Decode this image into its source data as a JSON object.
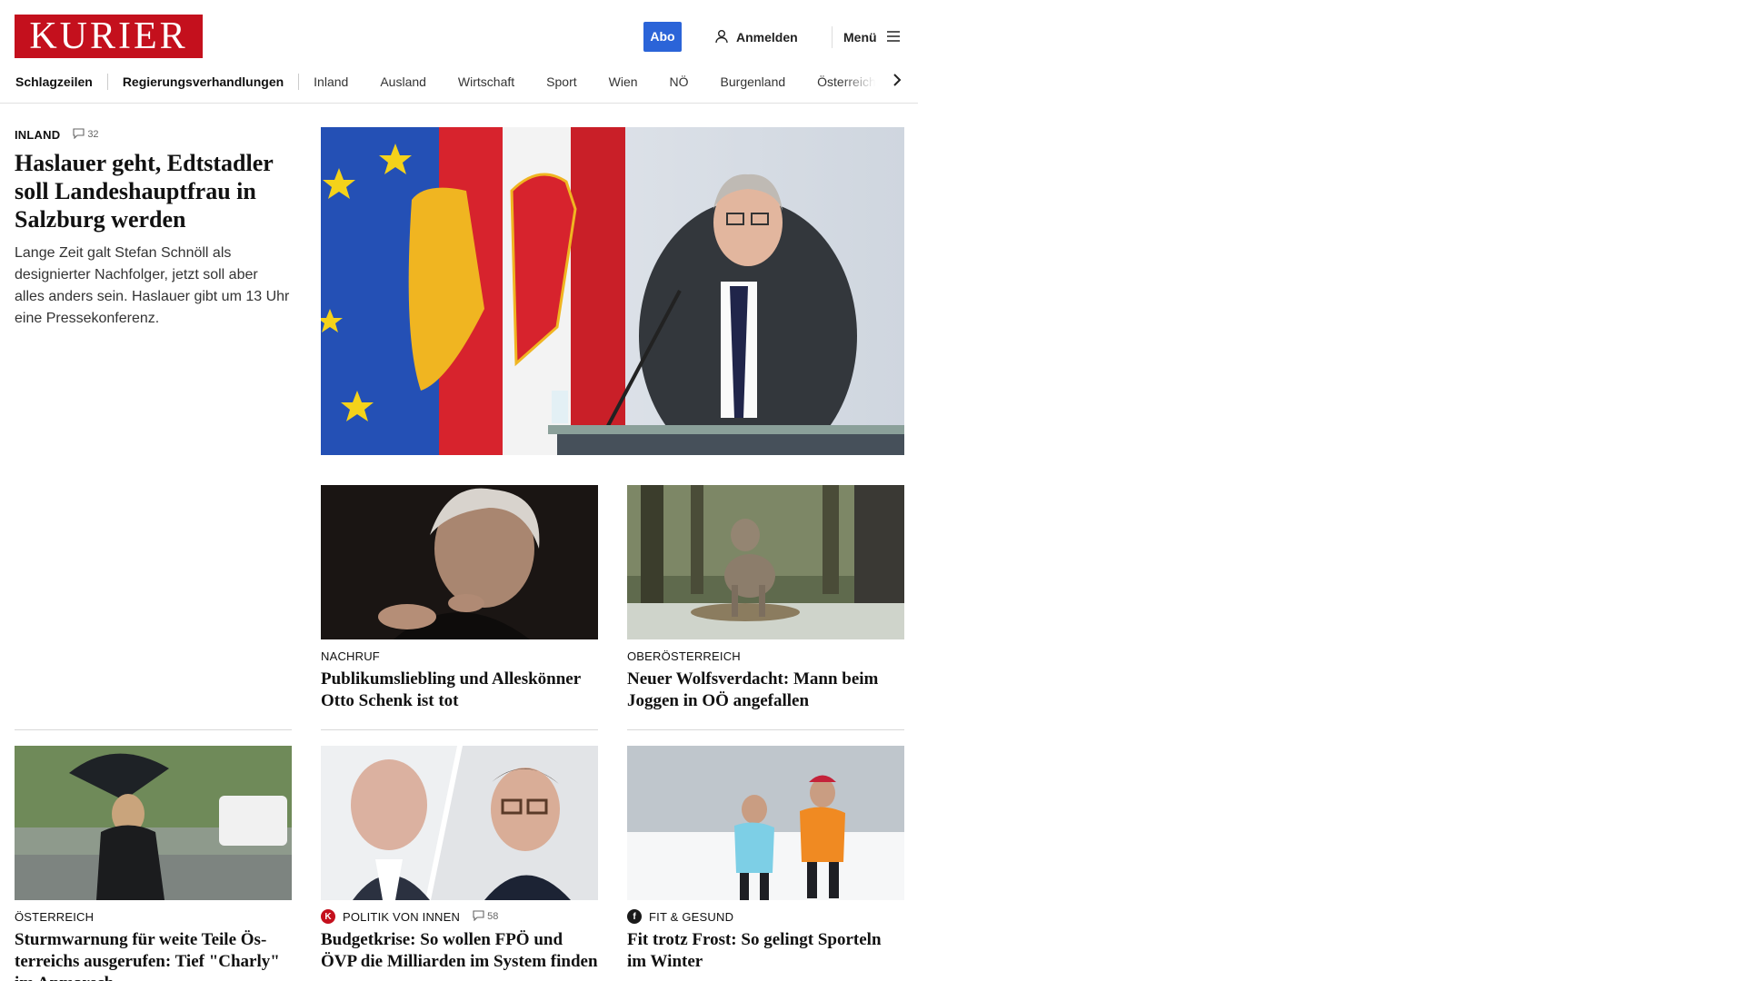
{
  "header": {
    "logo_text": "KURIER",
    "abo_label": "Abo",
    "login_label": "Anmelden",
    "menu_label": "Menü",
    "brand_color": "#c4101d",
    "accent_color": "#2b64d8"
  },
  "nav": {
    "items": [
      "Schlagzeilen",
      "Regierungsverhandlungen",
      "Inland",
      "Ausland",
      "Wirtschaft",
      "Sport",
      "Wien",
      "NÖ",
      "Burgenland",
      "Österreich"
    ]
  },
  "lead": {
    "kicker": "INLAND",
    "comments": "32",
    "title": "Haslauer geht, Edtstadler soll Landeshauptfrau in Salzburg werden",
    "teaser": "Lange Zeit galt Stefan Schnöll als designierter Nachfolger, jetzt soll aber alles anders sein. Haslauer gibt um 13 Uhr eine Pressekonferenz."
  },
  "cards": [
    {
      "kicker": "NACHRUF",
      "title": "Publikumsliebling und Alleskön­ner Otto Schenk ist tot"
    },
    {
      "kicker": "OBERÖSTERREICH",
      "title": "Neuer Wolfsverdacht: Mann beim Joggen in OÖ angefallen"
    },
    {
      "kicker": "ÖSTERREICH",
      "title": "Sturmwarnung für weite Teile Ös­terreichs ausgerufen: Tief \"Charly\" im Anmarsch"
    },
    {
      "kicker": "POLITIK VON INNEN",
      "comments": "58",
      "title": "Budgetkrise: So wollen FPÖ und ÖVP die Milliarden im System finden"
    },
    {
      "kicker": "FIT & GESUND",
      "title": "Fit trotz Frost: So gelingt Sporteln im Winter"
    }
  ]
}
